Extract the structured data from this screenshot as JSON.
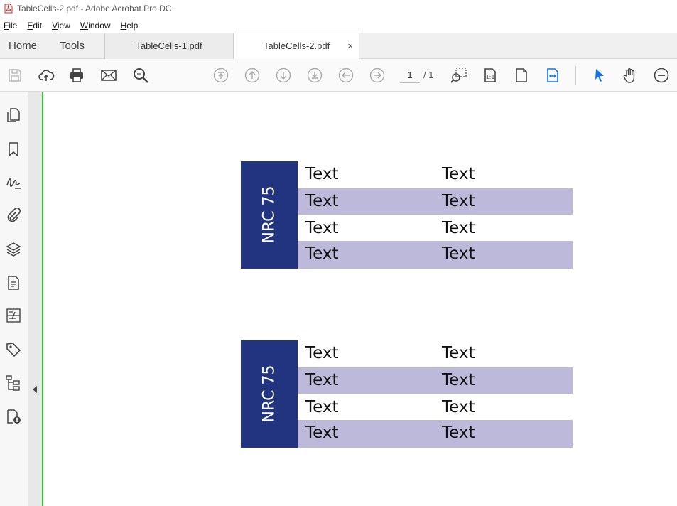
{
  "window": {
    "title": "TableCells-2.pdf - Adobe Acrobat Pro DC"
  },
  "menu": [
    "File",
    "Edit",
    "View",
    "Window",
    "Help"
  ],
  "tabs": {
    "home": "Home",
    "tools": "Tools",
    "documents": [
      {
        "label": "TableCells-1.pdf",
        "active": false
      },
      {
        "label": "TableCells-2.pdf",
        "active": true,
        "close": "×"
      }
    ]
  },
  "toolbar": {
    "page_current": "1",
    "page_total": "/ 1",
    "icons": [
      "save-icon",
      "upload-icon",
      "print-icon",
      "email-icon",
      "search-icon",
      "first-page-icon",
      "prev-page-icon",
      "next-page-icon",
      "last-page-icon",
      "back-icon",
      "forward-icon",
      "zoom-marquee-icon",
      "actual-size-icon",
      "fit-page-icon",
      "fit-width-icon",
      "select-cursor-icon",
      "hand-icon",
      "zoom-out-icon"
    ]
  },
  "left_panel": {
    "icons": [
      "pages-icon",
      "bookmark-icon",
      "signature-icon",
      "attachment-icon",
      "layers-icon",
      "content-icon",
      "compare-icon",
      "tags-icon",
      "structure-icon",
      "security-icon"
    ]
  },
  "document": {
    "tables": [
      {
        "side_label": "NRC 75",
        "rows": [
          [
            "Text",
            "Text"
          ],
          [
            "Text",
            "Text"
          ],
          [
            "Text",
            "Text"
          ],
          [
            "Text",
            "Text"
          ]
        ]
      },
      {
        "side_label": "NRC 75",
        "rows": [
          [
            "Text",
            "Text"
          ],
          [
            "Text",
            "Text"
          ],
          [
            "Text",
            "Text"
          ],
          [
            "Text",
            "Text"
          ]
        ]
      }
    ]
  },
  "colors": {
    "table_side": "#223380",
    "row_shade": "#bdb9da",
    "accent_blue": "#1473e6",
    "guide_green": "#2ec82e"
  }
}
